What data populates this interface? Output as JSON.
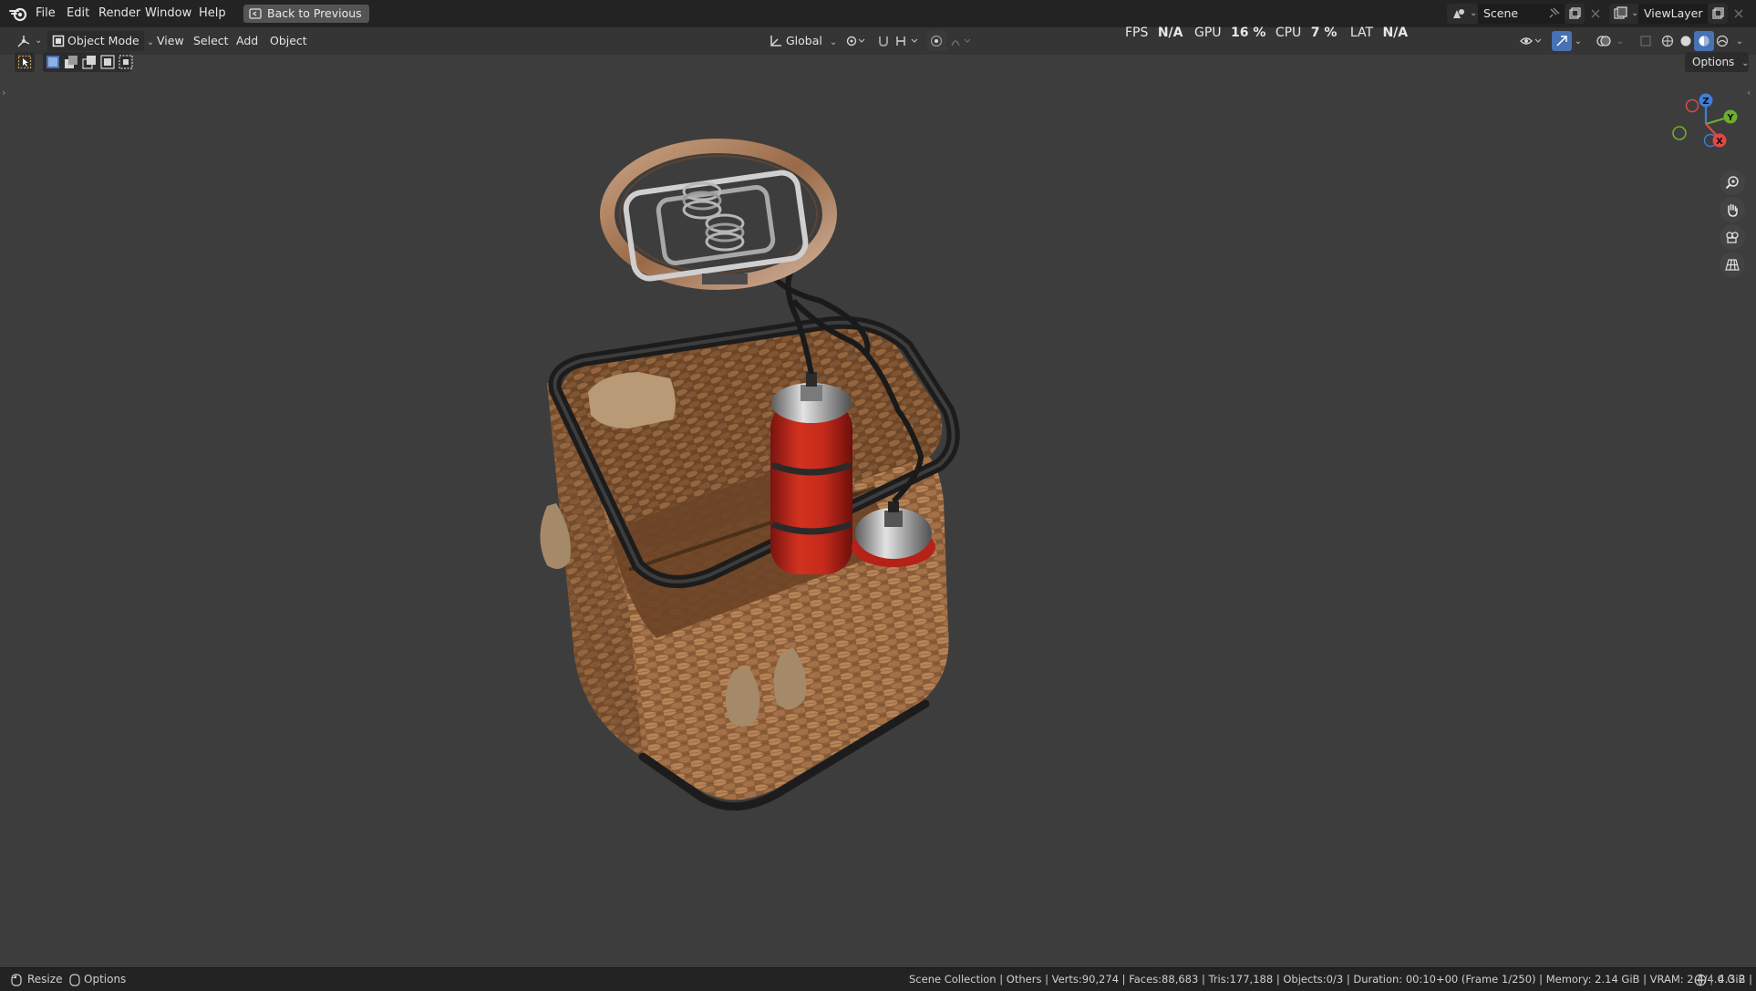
{
  "app": {
    "logo_icon": "blender-logo-icon",
    "menus": [
      "File",
      "Edit",
      "Render",
      "Window",
      "Help"
    ],
    "back_button": "Back to Previous",
    "scene_label": "Scene",
    "viewlayer_label": "ViewLayer"
  },
  "viewport_header": {
    "editor_icon": "3d-viewport-icon",
    "mode": "Object Mode",
    "menus": [
      "View",
      "Select",
      "Add",
      "Object"
    ],
    "transform_orientation": "Global",
    "options_label": "Options"
  },
  "performance": {
    "fps_label": "FPS",
    "fps_value": "N/A",
    "gpu_label": "GPU",
    "gpu_value": "16 %",
    "cpu_label": "CPU",
    "cpu_value": "7 %",
    "lat_label": "LAT",
    "lat_value": "N/A"
  },
  "gizmo": {
    "z": "Z",
    "y": "Y",
    "x": "X"
  },
  "statusbar": {
    "left_items": [
      "Resize",
      "Options"
    ],
    "info": "Scene Collection | Others | Verts:90,274 | Faces:88,683 | Tris:177,188 | Objects:0/3 | Duration: 00:10+00 (Frame 1/250) | Memory: 2.14 GiB | VRAM: 2.4/4.0 GiB |",
    "version": "4.3.2"
  },
  "colors": {
    "viewport_bg": "#3d3d3d",
    "header_bg": "#232323",
    "accent_blue": "#4772b3",
    "axis_x": "#e04848",
    "axis_y": "#6fae2c",
    "axis_z": "#3f7fd7",
    "basket_wicker": "#9a6b44",
    "gas_tank_red": "#c2241d"
  }
}
